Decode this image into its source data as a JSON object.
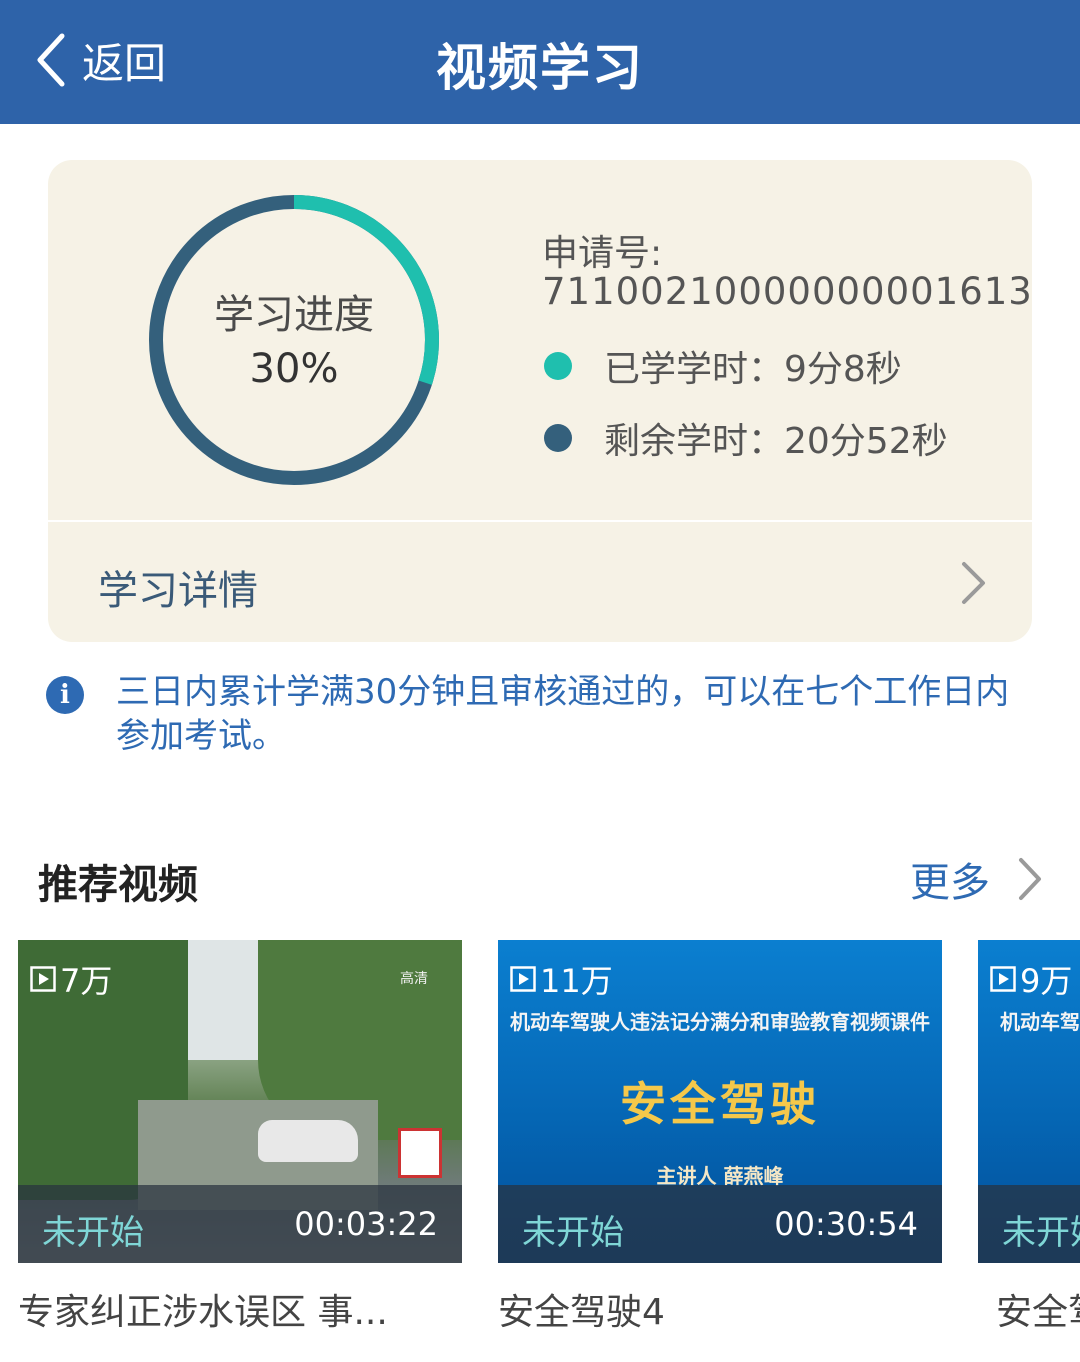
{
  "header": {
    "back_label": "返回",
    "title": "视频学习"
  },
  "progress": {
    "label": "学习进度",
    "value_text": "30%",
    "fraction": 0.3,
    "colors": {
      "done": "#1fbfae",
      "remaining": "#34607c"
    }
  },
  "application": {
    "label": "申请号:",
    "number": "71100210000000001613"
  },
  "stats": {
    "studied": "已学学时：9分8秒",
    "remaining": "剩余学时：20分52秒"
  },
  "details": {
    "label": "学习详情"
  },
  "notice": {
    "text": "三日内累计学满30分钟且审核通过的，可以在七个工作日内参加考试。"
  },
  "recommended": {
    "title": "推荐视频",
    "more_label": "更多",
    "videos": [
      {
        "views": "7万",
        "status": "未开始",
        "duration": "00:03:22",
        "caption": "专家纠正涉水误区 事...",
        "hd_label": "高清"
      },
      {
        "views": "11万",
        "status": "未开始",
        "duration": "00:30:54",
        "caption": "安全驾驶4",
        "thumb_subtitle": "机动车驾驶人违法记分满分和审验教育视频课件",
        "thumb_title": "安全驾驶",
        "thumb_lecturer": "主讲人 薛燕峰"
      },
      {
        "views": "9万",
        "status": "未开始",
        "caption": "安全驾",
        "thumb_subtitle": "机动车驾驶"
      }
    ]
  }
}
